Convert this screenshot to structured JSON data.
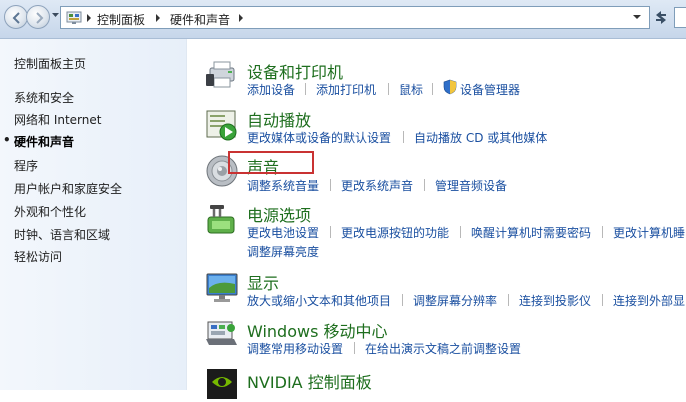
{
  "breadcrumb": {
    "items": [
      "控制面板",
      "硬件和声音"
    ]
  },
  "sidebar": {
    "items": [
      {
        "label": "控制面板主页",
        "current": false
      },
      {
        "label": "系统和安全",
        "current": false
      },
      {
        "label": "网络和 Internet",
        "current": false
      },
      {
        "label": "硬件和声音",
        "current": true
      },
      {
        "label": "程序",
        "current": false
      },
      {
        "label": "用户帐户和家庭安全",
        "current": false
      },
      {
        "label": "外观和个性化",
        "current": false
      },
      {
        "label": "时钟、语言和区域",
        "current": false
      },
      {
        "label": "轻松访问",
        "current": false
      }
    ]
  },
  "categories": [
    {
      "title": "设备和打印机",
      "icon": "printer-icon",
      "links": [
        "添加设备",
        "添加打印机",
        "鼠标",
        "设备管理器"
      ]
    },
    {
      "title": "自动播放",
      "icon": "autoplay-icon",
      "links": [
        "更改媒体或设备的默认设置",
        "自动播放 CD 或其他媒体"
      ]
    },
    {
      "title": "声音",
      "icon": "speaker-icon",
      "links": [
        "调整系统音量",
        "更改系统声音",
        "管理音频设备"
      ]
    },
    {
      "title": "电源选项",
      "icon": "power-options-icon",
      "links": [
        "更改电池设置",
        "更改电源按钮的功能",
        "唤醒计算机时需要密码",
        "更改计算机睡",
        "调整屏幕亮度"
      ]
    },
    {
      "title": "显示",
      "icon": "display-icon",
      "links": [
        "放大或缩小文本和其他项目",
        "调整屏幕分辨率",
        "连接到投影仪",
        "连接到外部显"
      ]
    },
    {
      "title": "Windows 移动中心",
      "icon": "mobility-center-icon",
      "links": [
        "调整常用移动设置",
        "在给出演示文稿之前调整设置"
      ]
    },
    {
      "title": "NVIDIA 控制面板",
      "icon": "nvidia-icon",
      "links": []
    }
  ],
  "colors": {
    "title_green": "#1e6e1e",
    "link_blue": "#1a4fa0",
    "highlight_red": "#c93232"
  }
}
